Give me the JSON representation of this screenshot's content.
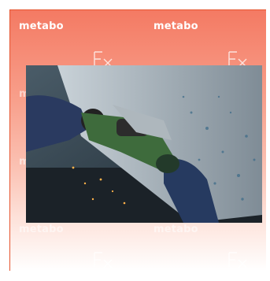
{
  "brand": {
    "logo_text": "metabo"
  },
  "colors": {
    "banner_top": "#f47a63",
    "banner_bottom": "#ffffff",
    "logo": "#ffffff",
    "tool_green": "#3e6b3c"
  },
  "photo": {
    "alt_description_icon": "angle-grinder-photo"
  }
}
